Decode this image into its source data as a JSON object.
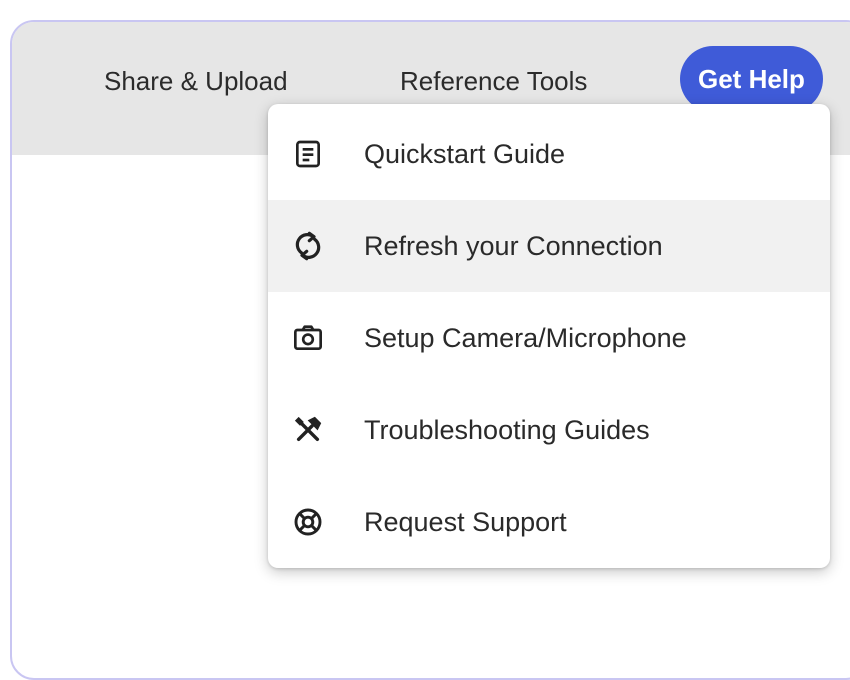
{
  "topbar": {
    "share_label": "Share & Upload",
    "reference_label": "Reference Tools",
    "help_label": "Get Help",
    "help_color": "#3f5bd8"
  },
  "help_menu": {
    "items": [
      {
        "label": "Quickstart Guide",
        "icon": "document-icon"
      },
      {
        "label": "Refresh your Connection",
        "icon": "refresh-icon",
        "hovered": true
      },
      {
        "label": "Setup Camera/Microphone",
        "icon": "camera-icon"
      },
      {
        "label": "Troubleshooting Guides",
        "icon": "tools-icon"
      },
      {
        "label": "Request Support",
        "icon": "lifebuoy-icon"
      }
    ]
  }
}
